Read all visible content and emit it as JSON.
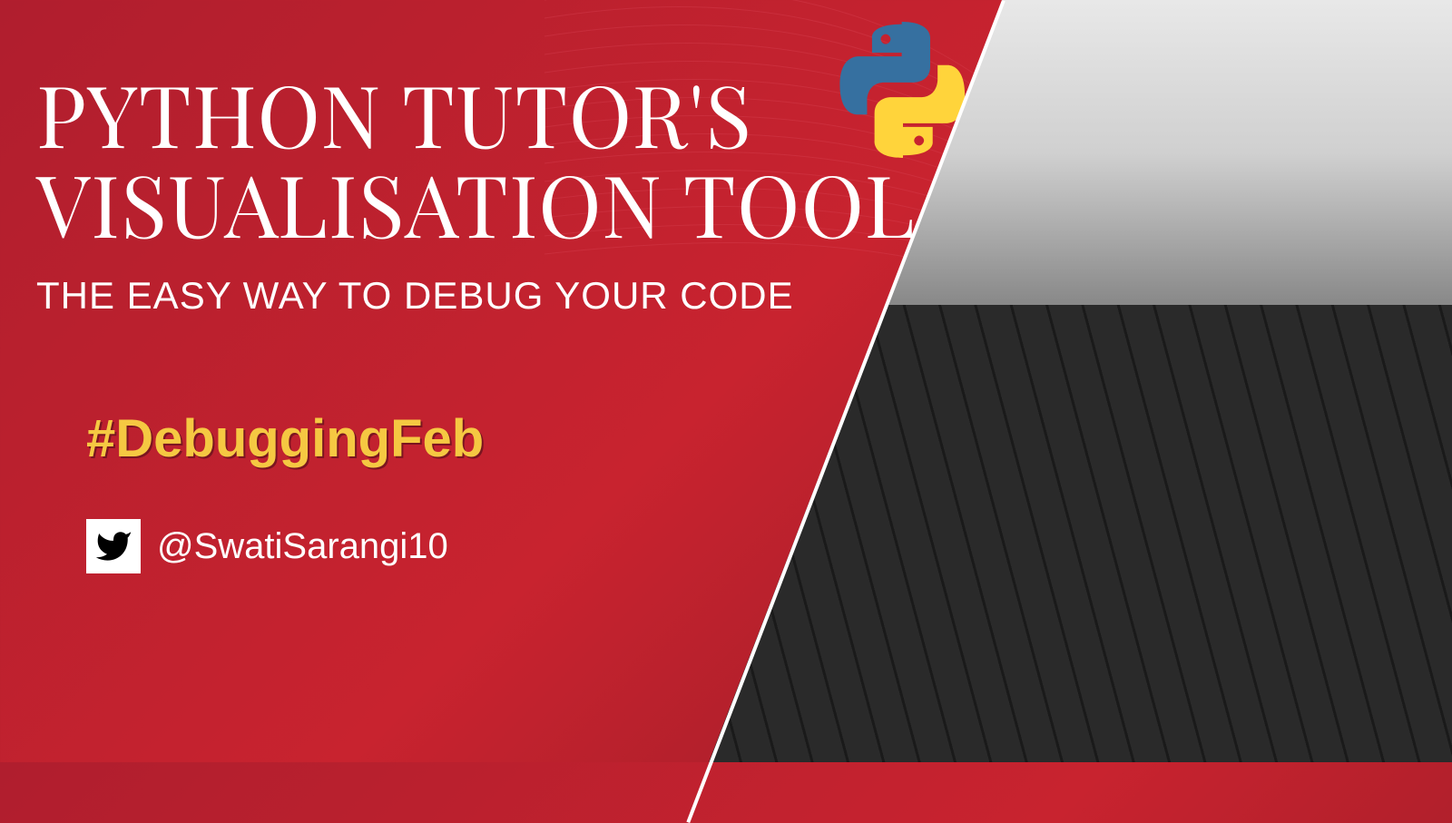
{
  "title_line1": "PYTHON TUTOR'S",
  "title_line2": "VISUALISATION TOOL",
  "subtitle": "THE EASY WAY TO DEBUG YOUR CODE",
  "hashtag": "#DebuggingFeb",
  "twitter_handle": "@SwatiSarangi10",
  "colors": {
    "background_red": "#c8232f",
    "hashtag_yellow": "#f5c842",
    "text_white": "#ffffff"
  },
  "icons": {
    "python_logo": "python-logo",
    "twitter": "twitter-icon"
  }
}
